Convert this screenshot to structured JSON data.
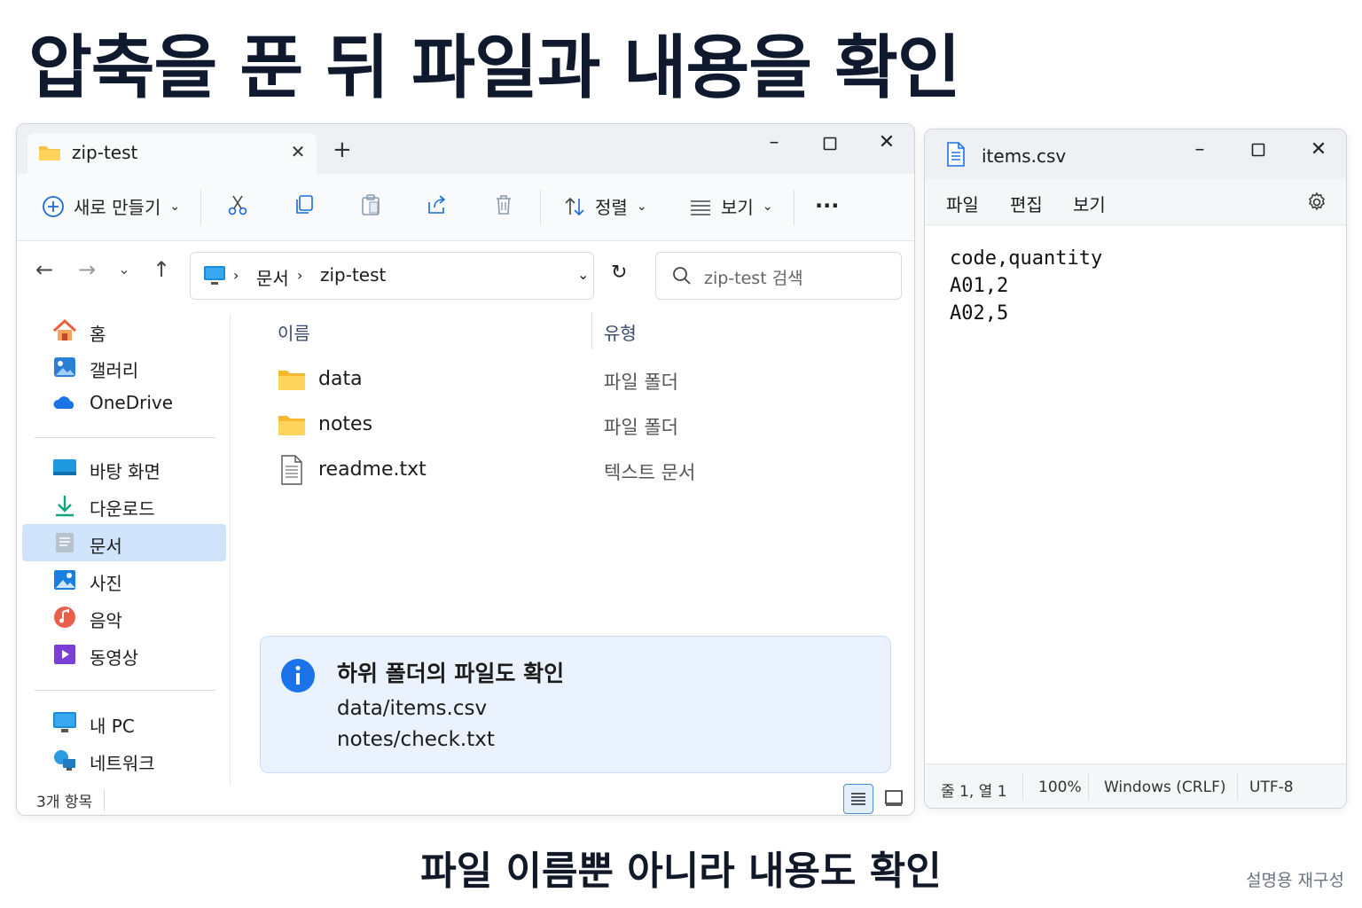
{
  "headline": "압축을 푼 뒤 파일과 내용을 확인",
  "footer_caption": "파일 이름뿐 아니라 내용도 확인",
  "watermark": "설명용 재구성",
  "explorer": {
    "tab_title": "zip-test",
    "toolbar": {
      "new_label": "새로 만들기",
      "sort_label": "정렬",
      "view_label": "보기"
    },
    "address": {
      "crumbs": [
        "문서",
        "zip-test"
      ]
    },
    "search": {
      "placeholder": "zip-test 검색"
    },
    "sidebar": {
      "items": [
        {
          "label": "홈",
          "icon": "home-icon"
        },
        {
          "label": "갤러리",
          "icon": "gallery-icon"
        },
        {
          "label": "OneDrive",
          "icon": "cloud-icon"
        },
        {
          "label": "바탕 화면",
          "icon": "desktop-icon"
        },
        {
          "label": "다운로드",
          "icon": "download-icon"
        },
        {
          "label": "문서",
          "icon": "document-icon",
          "selected": true
        },
        {
          "label": "사진",
          "icon": "pictures-icon"
        },
        {
          "label": "음악",
          "icon": "music-icon"
        },
        {
          "label": "동영상",
          "icon": "video-icon"
        },
        {
          "label": "내 PC",
          "icon": "computer-icon"
        },
        {
          "label": "네트워크",
          "icon": "network-icon"
        }
      ]
    },
    "columns": {
      "name": "이름",
      "type": "유형"
    },
    "files": [
      {
        "name": "data",
        "type": "파일 폴더",
        "icon": "folder-icon"
      },
      {
        "name": "notes",
        "type": "파일 폴더",
        "icon": "folder-icon"
      },
      {
        "name": "readme.txt",
        "type": "텍스트 문서",
        "icon": "text-file-icon"
      }
    ],
    "info": {
      "title": "하위 폴더의 파일도 확인",
      "lines": [
        "data/items.csv",
        "notes/check.txt"
      ]
    },
    "status": {
      "count": "3개 항목"
    }
  },
  "notepad": {
    "title": "items.csv",
    "menu": [
      "파일",
      "편집",
      "보기"
    ],
    "content_lines": [
      "code,quantity",
      "A01,2",
      "A02,5"
    ],
    "status": {
      "position": "줄 1, 열 1",
      "zoom": "100%",
      "line_ending": "Windows (CRLF)",
      "encoding": "UTF-8"
    }
  },
  "colors": {
    "accent": "#1a73e8",
    "selected_bg": "#cfe4fa",
    "info_bg": "#eaf3fd",
    "folder": "#f5c242"
  }
}
